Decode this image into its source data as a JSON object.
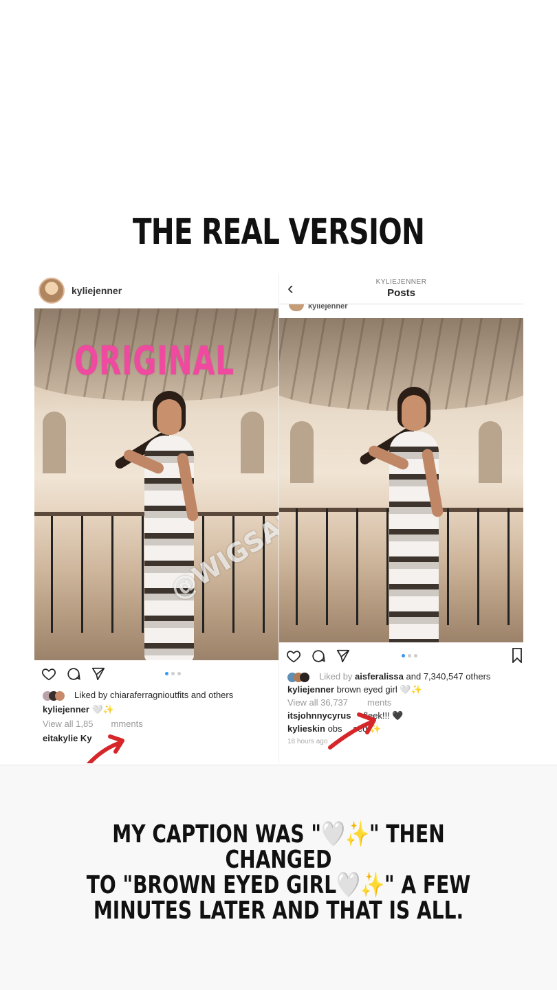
{
  "story": {
    "title": "THE REAL VERSION",
    "caption": "MY CAPTION WAS \"🤍✨\" THEN CHANGED\nTO \"BROWN EYED GIRL🤍✨\" A FEW\nMINUTES LATER AND THAT IS ALL."
  },
  "left_post": {
    "username": "kyliejenner",
    "overlay_label": "ORIGINAL",
    "liked_by": "Liked by chiaraferragnioutfits and others",
    "caption_user": "kyliejenner",
    "caption_text": "🤍✨",
    "view_comments": "View all 1,85",
    "view_comments_tail": "mments",
    "comment_user": "eitakylie Ky"
  },
  "right_post": {
    "nav_sub": "KYLIEJENNER",
    "nav_title": "Posts",
    "cutoff_username": "kyliejenner",
    "watermark": "@WIGSANDTEA",
    "liked_prefix": "Liked by",
    "liked_user": "aisferalissa",
    "liked_suffix": "and 7,340,547 others",
    "caption_user": "kyliejenner",
    "caption_text": "brown eyed girl 🤍✨",
    "view_comments": "View all 36,737",
    "view_comments_tail": "ments",
    "comment1_user": "itsjohnnycyrus",
    "comment1_text": "fleek!!! 🖤",
    "comment2_user": "kylieskin",
    "comment2_text": "obs",
    "comment2_tail": "sed ✨",
    "timestamp": "18 hours ago"
  },
  "icons": [
    "heart-icon",
    "comment-icon",
    "share-icon",
    "bookmark-icon",
    "back-chevron-icon",
    "red-arrow-annotation"
  ],
  "colors": {
    "overlay_pink": "#ef4aa0",
    "annotation_red": "#d6262a",
    "carousel_active": "#3897f0"
  }
}
